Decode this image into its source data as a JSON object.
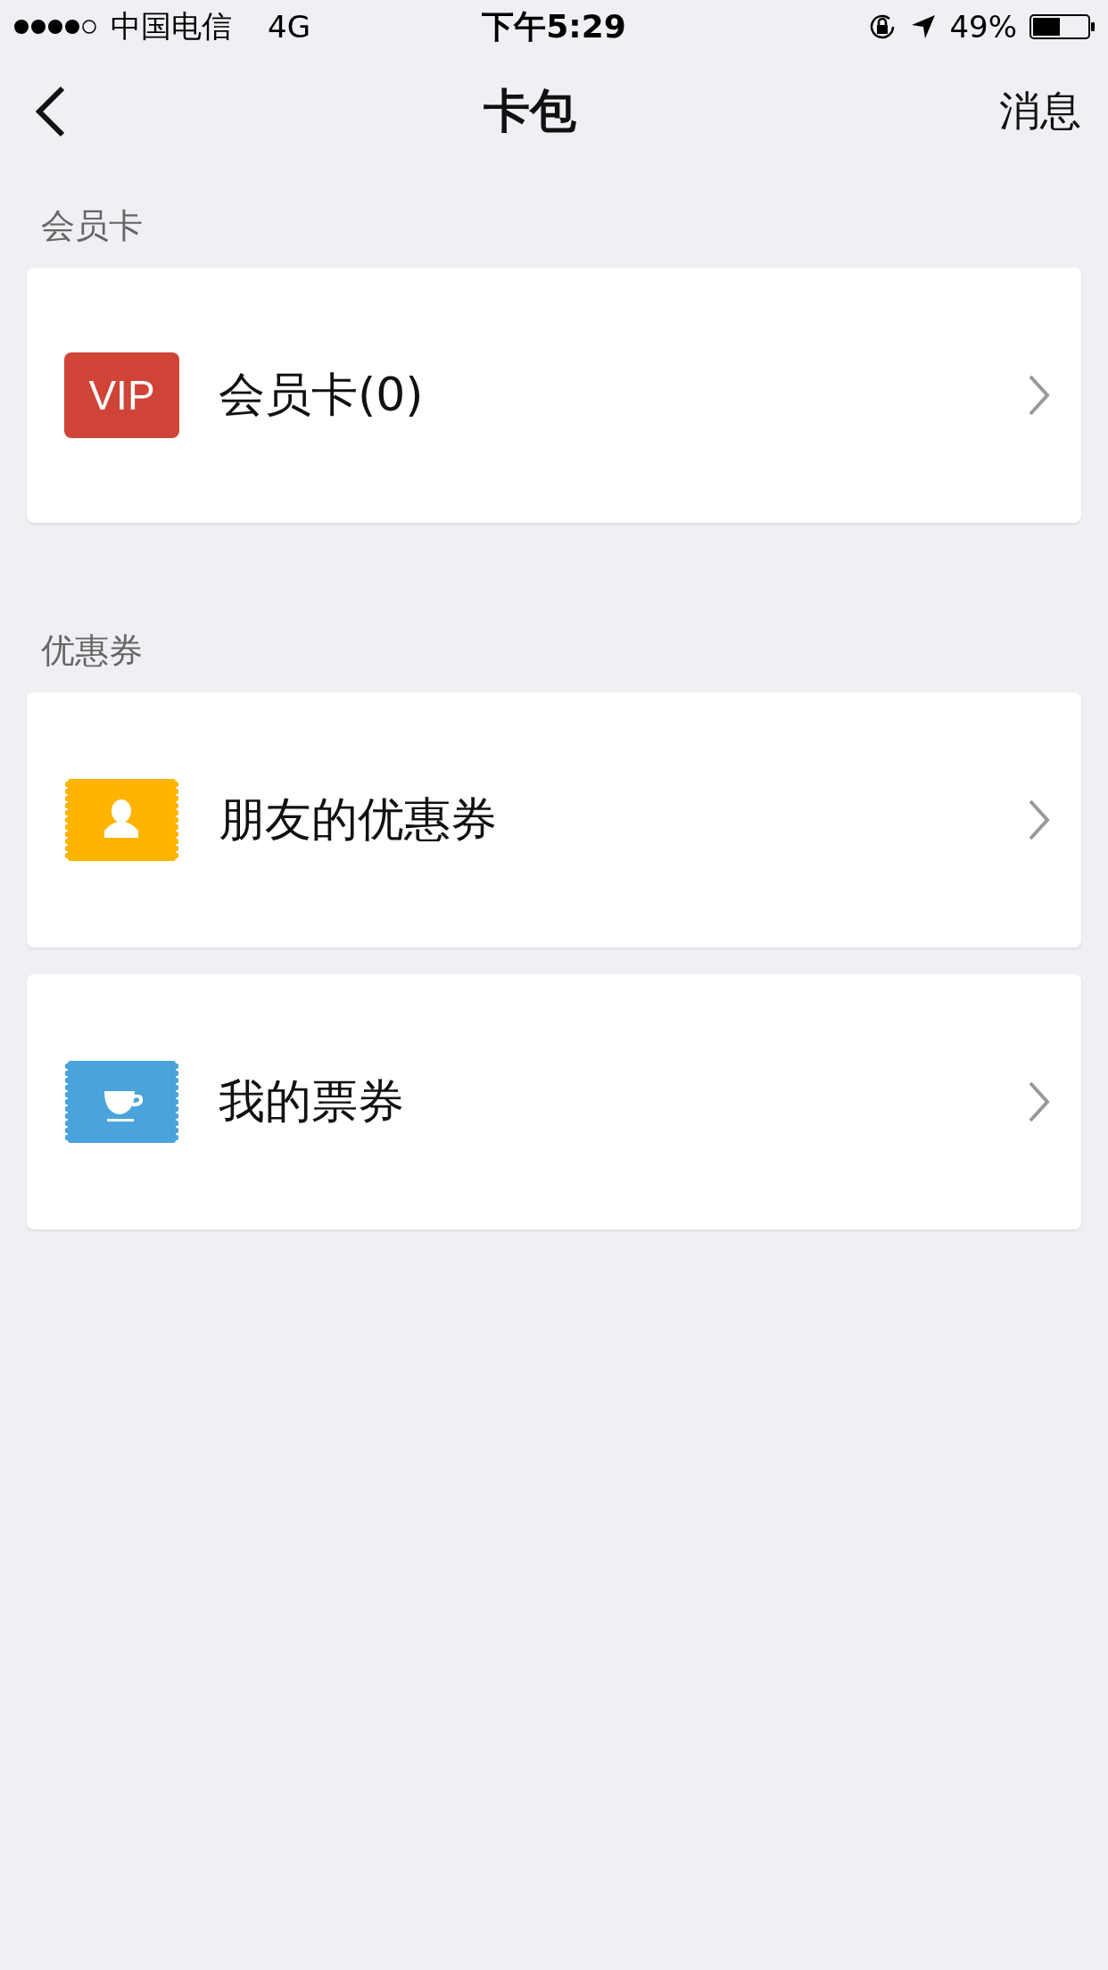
{
  "status_bar": {
    "carrier": "中国电信",
    "network": "4G",
    "time": "下午5:29",
    "battery": "49%"
  },
  "nav": {
    "title": "卡包",
    "action": "消息"
  },
  "sections": [
    {
      "label": "会员卡",
      "items": [
        {
          "kind": "vip",
          "badge": "VIP",
          "title": "会员卡(0)"
        }
      ]
    },
    {
      "label": "优惠券",
      "items": [
        {
          "kind": "friend",
          "title": "朋友的优惠券"
        },
        {
          "kind": "cup",
          "title": "我的票券"
        }
      ]
    }
  ]
}
